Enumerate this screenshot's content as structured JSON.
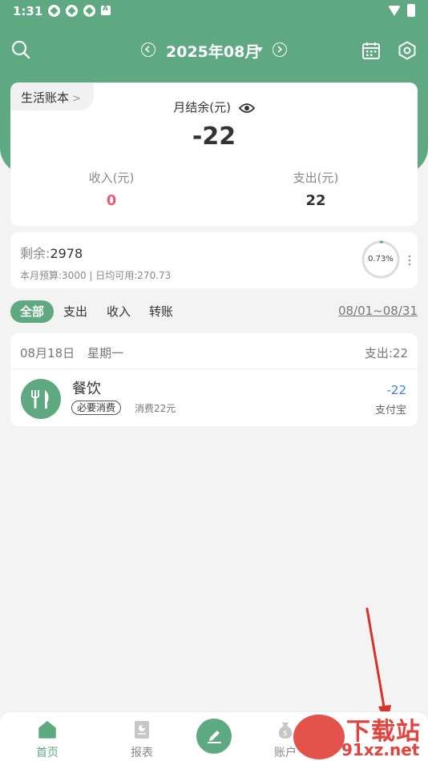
{
  "status_bar": {
    "time": "1:31"
  },
  "header": {
    "month": "2025年08月"
  },
  "summary": {
    "book_name": "生活账本",
    "balance_label": "月结余(元)",
    "balance_value": "-22",
    "income_label": "收入(元)",
    "income_value": "0",
    "expense_label": "支出(元)",
    "expense_value": "22"
  },
  "budget": {
    "remaining_key": "剩余:",
    "remaining_value": "2978",
    "detail": "本月预算:3000 | 日均可用:270.73",
    "percent_text": "0.73%",
    "percent": 0.73
  },
  "filters": {
    "tabs": [
      "全部",
      "支出",
      "收入",
      "转账"
    ],
    "active": "全部",
    "date_range": "08/01~08/31"
  },
  "records": {
    "date": "08月18日",
    "weekday": "星期一",
    "total": "支出:22",
    "items": [
      {
        "category": "餐饮",
        "tag": "必要消费",
        "note": "消费22元",
        "amount": "-22",
        "account": "支付宝"
      }
    ]
  },
  "bottom_nav": {
    "home": "首页",
    "report": "报表",
    "account": "账户"
  },
  "watermark": {
    "line1": "下载站",
    "line2": "91xz.net"
  },
  "colors": {
    "brand": "#5ea882",
    "income": "#ea5a7a",
    "amount": "#3f7fd6",
    "arrow": "#d9302a"
  }
}
